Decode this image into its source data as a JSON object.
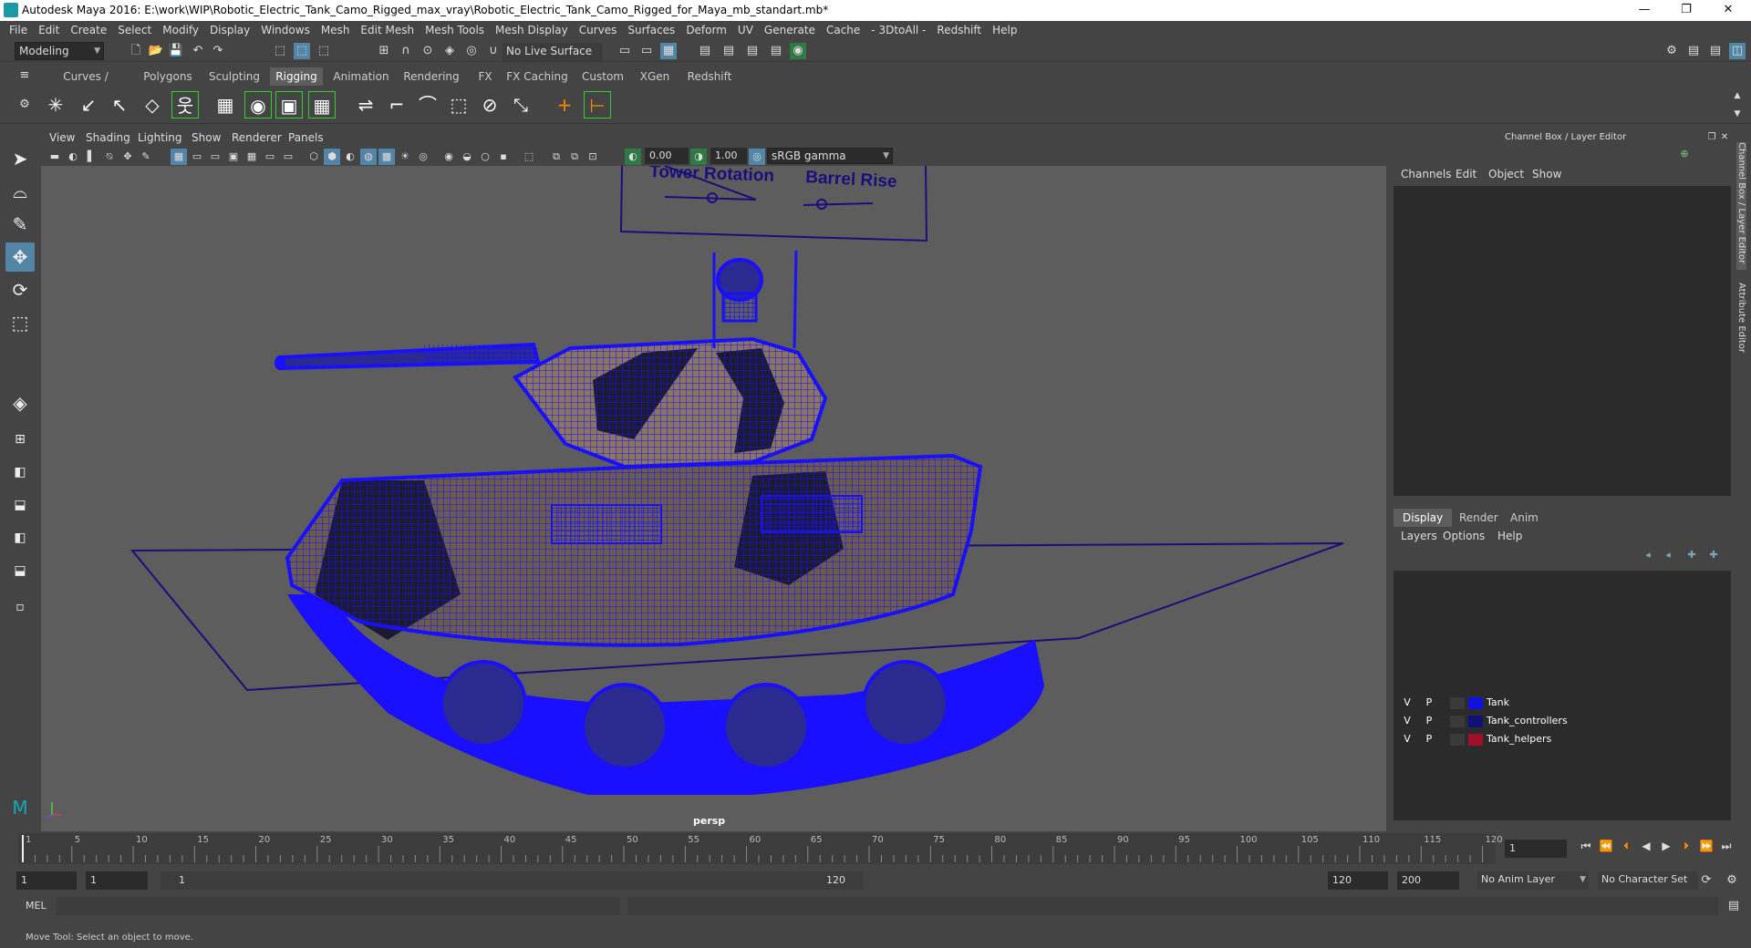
{
  "window": {
    "title": "Autodesk Maya 2016: E:\\work\\WIP\\Robotic_Electric_Tank_Camo_Rigged_max_vray\\Robotic_Electric_Tank_Camo_Rigged_for_Maya_mb_standart.mb*",
    "minimize": "—",
    "restore": "❐",
    "close": "✕"
  },
  "menubar": [
    "File",
    "Edit",
    "Create",
    "Select",
    "Modify",
    "Display",
    "Windows",
    "Mesh",
    "Edit Mesh",
    "Mesh Tools",
    "Mesh Display",
    "Curves",
    "Surfaces",
    "Deform",
    "UV",
    "Generate",
    "Cache",
    "- 3DtoAll -",
    "Redshift",
    "Help"
  ],
  "statusline": {
    "mode": "Modeling",
    "live_surface": "No Live Surface"
  },
  "shelf_tabs": [
    "Curves / Surfaces",
    "Polygons",
    "Sculpting",
    "Rigging",
    "Animation",
    "Rendering",
    "FX",
    "FX Caching",
    "Custom",
    "XGen",
    "Redshift"
  ],
  "shelf_active": "Rigging",
  "viewport": {
    "menu": [
      "View",
      "Shading",
      "Lighting",
      "Show",
      "Renderer",
      "Panels"
    ],
    "exposure": "0.00",
    "gamma": "1.00",
    "colorspace": "sRGB gamma",
    "camera": "persp",
    "scene_labels": {
      "tower": "Tower Rotation",
      "barrel": "Barrel Rise"
    }
  },
  "right_panel": {
    "title": "Channel Box / Layer Editor",
    "channel_menu": [
      "Channels",
      "Edit",
      "Object",
      "Show"
    ],
    "layer_tabs": [
      "Display",
      "Render",
      "Anim"
    ],
    "layer_active": "Display",
    "layer_menu": [
      "Layers",
      "Options",
      "Help"
    ],
    "layers": [
      {
        "v": "V",
        "p": "P",
        "name": "Tank",
        "color": "#1010e0"
      },
      {
        "v": "V",
        "p": "P",
        "name": "Tank_controllers",
        "color": "#10107a"
      },
      {
        "v": "V",
        "p": "P",
        "name": "Tank_helpers",
        "color": "#a0102a"
      }
    ],
    "side_tabs": [
      "Channel Box / Layer Editor",
      "Attribute Editor"
    ]
  },
  "timeline": {
    "ticks": [
      "1",
      "5",
      "10",
      "15",
      "20",
      "25",
      "30",
      "35",
      "40",
      "45",
      "50",
      "55",
      "60",
      "65",
      "70",
      "75",
      "80",
      "85",
      "90",
      "95",
      "100",
      "105",
      "110",
      "115",
      "120"
    ],
    "current_frame": "1"
  },
  "range": {
    "start": "1",
    "start_inner": "1",
    "slider_start": "1",
    "slider_end": "120",
    "end_inner": "120",
    "end": "200",
    "anim_layer": "No Anim Layer",
    "char_set": "No Character Set"
  },
  "command": {
    "label": "MEL"
  },
  "help_line": "Move Tool: Select an object to move.",
  "colors": {
    "wire": "#1a10ff",
    "viewport_bg": "#5d5d5d",
    "accent": "#5285a6"
  }
}
